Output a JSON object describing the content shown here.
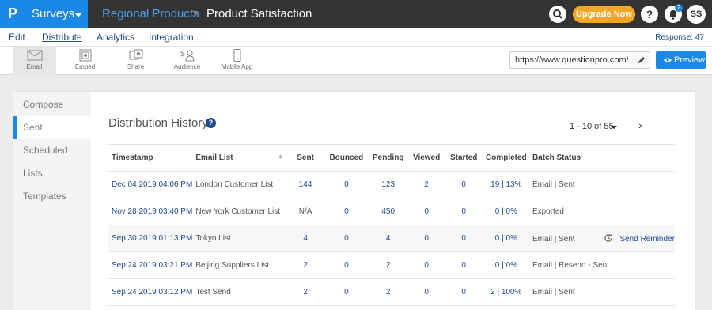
{
  "app": {
    "logo": "P",
    "product": "Surveys"
  },
  "breadcrumb": {
    "parent": "Regional Products",
    "separator": ">",
    "current": "Product Satisfaction"
  },
  "header": {
    "upgrade_label": "Upgrade Now",
    "help_label": "?",
    "notification_count": "2",
    "avatar_initials": "SS"
  },
  "menu": {
    "items": [
      "Edit",
      "Distribute",
      "Analytics",
      "Integration"
    ],
    "active": "Distribute",
    "response_count": "Response: 47"
  },
  "toolbar": {
    "tools": [
      {
        "label": "Email",
        "icon": "envelope-icon"
      },
      {
        "label": "Embed",
        "icon": "embed-icon"
      },
      {
        "label": "Share",
        "icon": "share-icon"
      },
      {
        "label": "Audience",
        "icon": "audience-icon"
      },
      {
        "label": "Mobile App",
        "icon": "mobile-icon"
      }
    ],
    "url": "https://www.questionpro.com/t/A",
    "preview_label": "Preview"
  },
  "sidenav": {
    "items": [
      "Compose",
      "Sent",
      "Scheduled",
      "Lists",
      "Templates"
    ],
    "active": "Sent"
  },
  "history": {
    "title": "Distribution History",
    "pager": "1 - 10 of 55",
    "columns": [
      "Timestamp",
      "Email List",
      "Sent",
      "Bounced",
      "Pending",
      "Viewed",
      "Started",
      "Completed",
      "Batch Status"
    ],
    "rows": [
      {
        "timestamp": "Dec 04 2019 04:06 PM",
        "list": "London Customer List",
        "sent": "144",
        "bounced": "0",
        "pending": "123",
        "viewed": "2",
        "started": "0",
        "completed": "19 | 13%",
        "status": "Email | Sent",
        "action": ""
      },
      {
        "timestamp": "Nov 28 2019 03:40 PM",
        "list": "New York Customer List",
        "sent": "N/A",
        "bounced": "0",
        "pending": "450",
        "viewed": "0",
        "started": "0",
        "completed": "0 | 0%",
        "status": "Exported",
        "action": ""
      },
      {
        "timestamp": "Sep 30 2019 01:13 PM",
        "list": "Tokyo List",
        "sent": "4",
        "bounced": "0",
        "pending": "4",
        "viewed": "0",
        "started": "0",
        "completed": "0 | 0%",
        "status": "Email | Sent",
        "action": "Send Reminder"
      },
      {
        "timestamp": "Sep 24 2019 03:21 PM",
        "list": "Beijing Suppliers List",
        "sent": "2",
        "bounced": "0",
        "pending": "2",
        "viewed": "0",
        "started": "0",
        "completed": "0 | 0%",
        "status": "Email | Resend - Sent",
        "action": ""
      },
      {
        "timestamp": "Sep 24 2019 03:12 PM",
        "list": "Test Send",
        "sent": "2",
        "bounced": "0",
        "pending": "2",
        "viewed": "0",
        "started": "0",
        "completed": "2 | 100%",
        "status": "Email | Sent",
        "action": ""
      }
    ]
  },
  "colors": {
    "brand": "#1b87e6",
    "topbar": "#333333",
    "upgrade": "#f5a623",
    "link": "#1e4c8f"
  }
}
